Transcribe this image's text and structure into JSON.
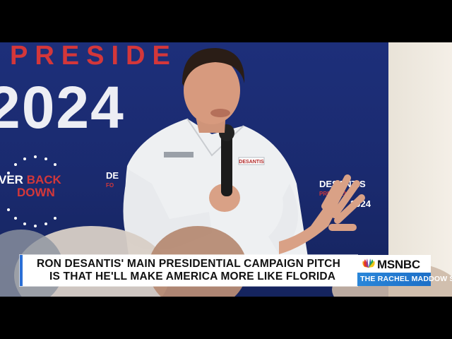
{
  "backdrop": {
    "banner_top": "PRESIDE",
    "banner_year": "2024",
    "seal_line1_prefix": "VER",
    "seal_line1_suffix": "BACK",
    "seal_line2": "DOWN",
    "logo_left_main": "DE",
    "logo_left_sub": "FO",
    "logo_right_main": "DESANTIS",
    "logo_right_sub": "PRESIDENT",
    "logo_right_year": "2024",
    "shirt_logo": "DESANTIS"
  },
  "chyron": {
    "line1": "RON DESANTIS' MAIN PRESIDENTIAL CAMPAIGN PITCH",
    "line2": "IS THAT HE'LL MAKE AMERICA MORE LIKE FLORIDA"
  },
  "brand": {
    "network": "MSNBC",
    "show": "THE RACHEL MADDOW SHOW"
  },
  "colors": {
    "backdrop_blue": "#1d2f7a",
    "banner_red": "#d4373a",
    "chyron_accent": "#2b6fd6",
    "show_bar": "#2a86d9"
  }
}
